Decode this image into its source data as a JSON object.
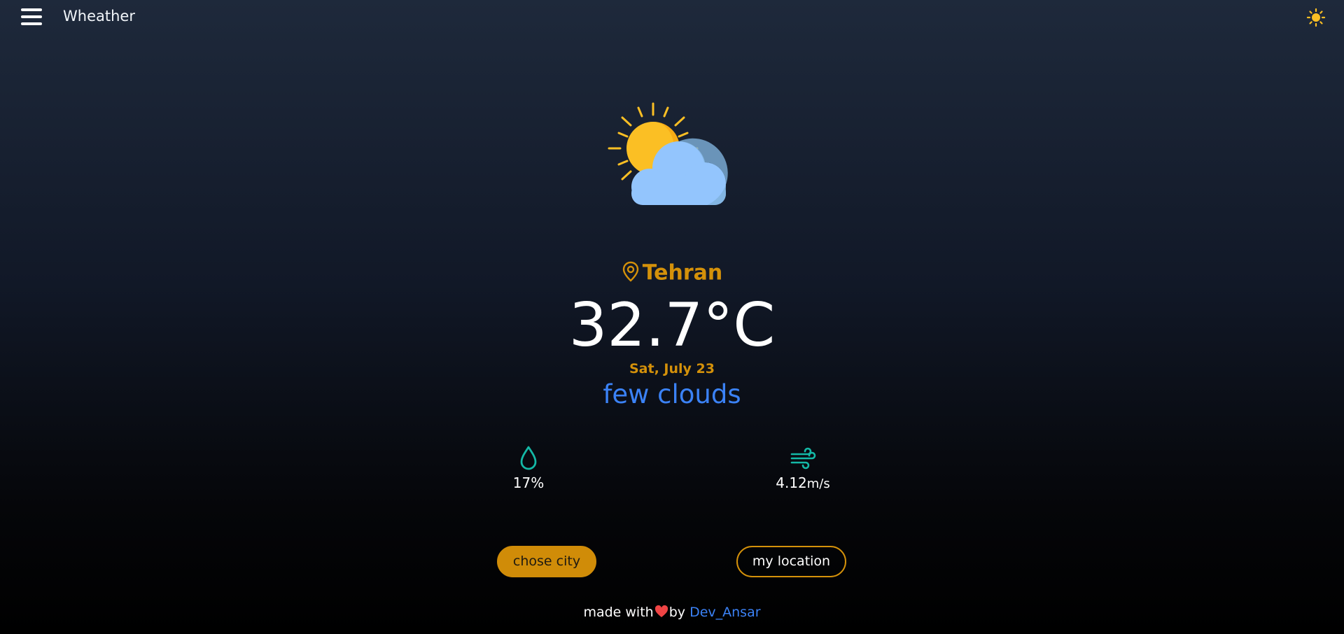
{
  "header": {
    "title": "Wheather",
    "menu_icon": "hamburger-menu-icon",
    "theme_icon": "sun-icon"
  },
  "weather": {
    "icon": "partly-cloudy-icon",
    "city": "Tehran",
    "temperature": "32.7°C",
    "date": "Sat, July 23",
    "condition": "few clouds"
  },
  "stats": {
    "humidity": {
      "icon": "water-drop-icon",
      "value": "17%"
    },
    "wind": {
      "icon": "wind-icon",
      "value": "4.12",
      "unit": "m/s"
    }
  },
  "actions": {
    "choose_city_label": "chose city",
    "my_location_label": "my location"
  },
  "footer": {
    "made_with": "made with",
    "by": "by",
    "author": "Dev_Ansar"
  },
  "colors": {
    "accent": "#d4910a",
    "link": "#3b82f6",
    "sun": "#fbbf24",
    "cloud": "#93c5fd",
    "teal": "#14b8a6"
  }
}
